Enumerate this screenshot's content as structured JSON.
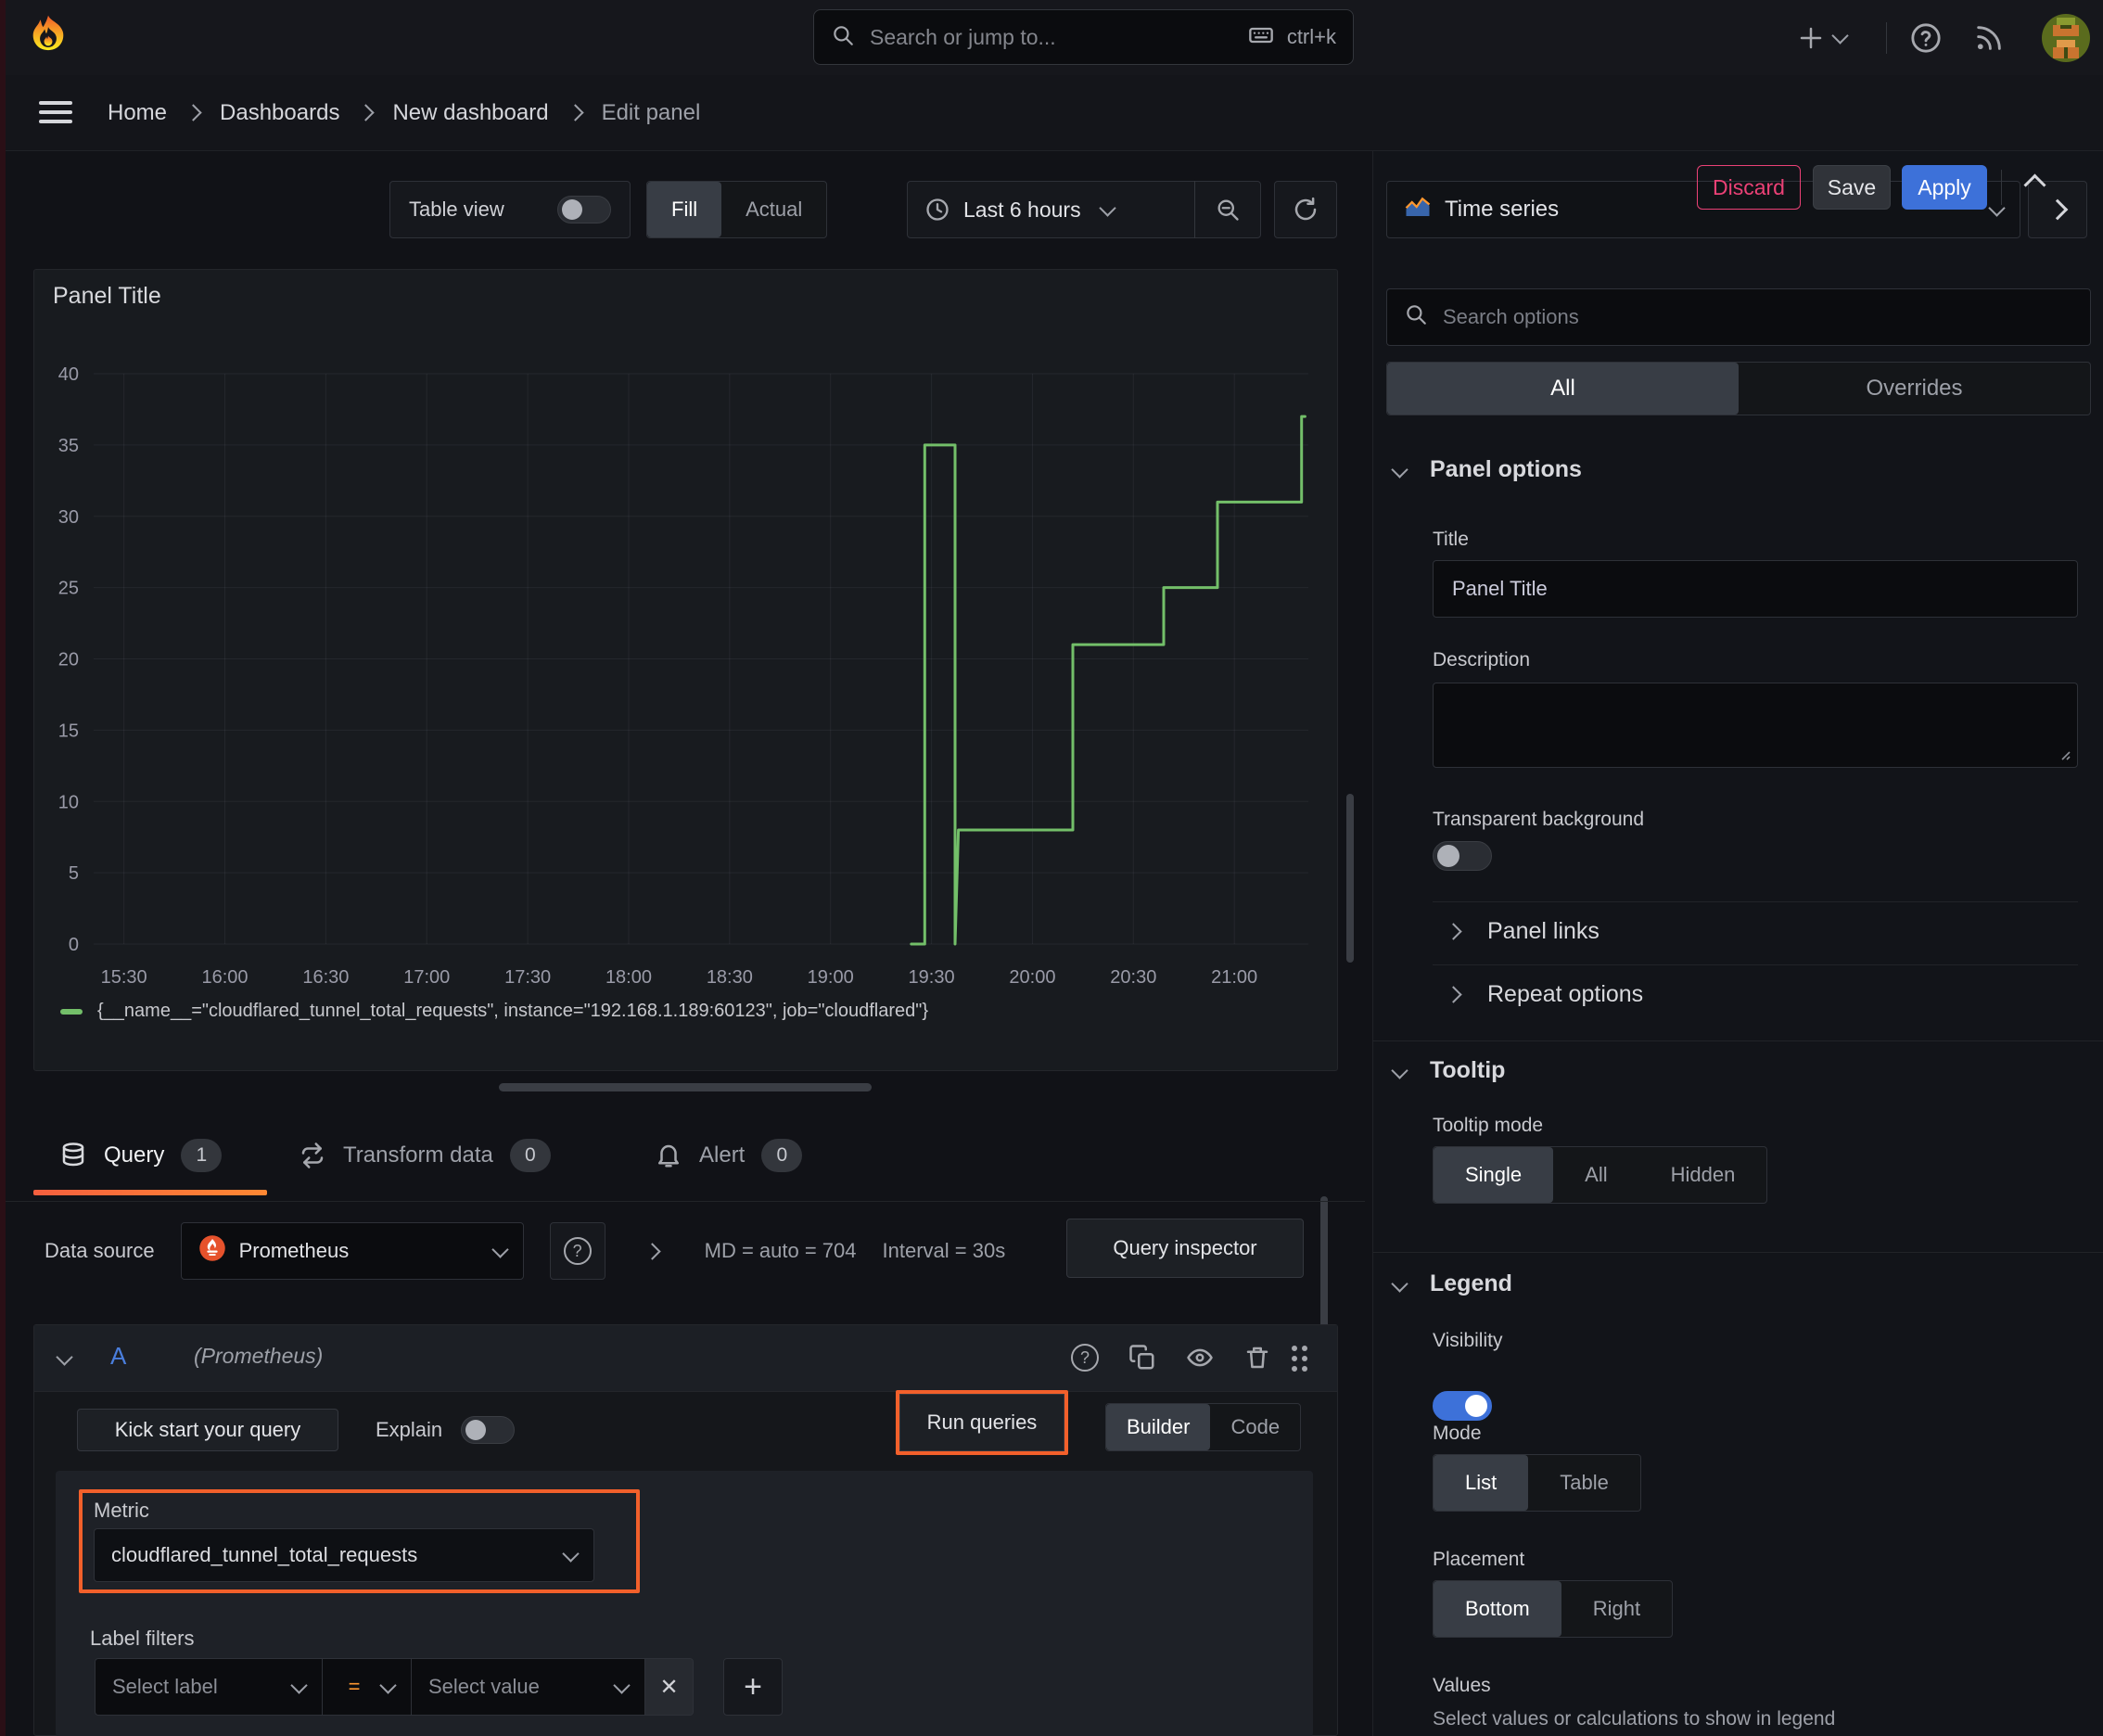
{
  "colors": {
    "green": "#73BF69",
    "blue": "#3D71D9",
    "annotation_orange": "#F2602B",
    "discard_red": "#EB4176",
    "tab_underline": "#FF8833"
  },
  "icons": {
    "plus": "+",
    "close": "✕",
    "help": "?"
  },
  "topnav": {
    "search_placeholder": "Search or jump to...",
    "shortcut": "ctrl+k"
  },
  "breadcrumb": {
    "items": [
      "Home",
      "Dashboards",
      "New dashboard",
      "Edit panel"
    ]
  },
  "actions": {
    "discard": "Discard",
    "save": "Save",
    "apply": "Apply"
  },
  "toolbar": {
    "table_view": "Table view",
    "fill": "Fill",
    "actual": "Actual",
    "time_range": "Last 6 hours"
  },
  "panel": {
    "title": "Panel Title"
  },
  "chart_data": {
    "type": "line",
    "step": true,
    "title": "Panel Title",
    "x_ticks": [
      "15:30",
      "16:00",
      "16:30",
      "17:00",
      "17:30",
      "18:00",
      "18:30",
      "19:00",
      "19:30",
      "20:00",
      "20:30",
      "21:00"
    ],
    "y_ticks": [
      0,
      5,
      10,
      15,
      20,
      25,
      30,
      35,
      40
    ],
    "x_range": [
      "15:21",
      "21:22"
    ],
    "y_range": [
      0,
      40
    ],
    "grid": true,
    "legend_position": "bottom",
    "series": [
      {
        "name": "{__name__=\"cloudflared_tunnel_total_requests\", instance=\"192.168.1.189:60123\", job=\"cloudflared\"}",
        "color": "#73BF69",
        "points": [
          {
            "time": "19:24",
            "value": 0
          },
          {
            "time": "19:28",
            "value": 0
          },
          {
            "time": "19:28",
            "value": 35
          },
          {
            "time": "19:37",
            "value": 35
          },
          {
            "time": "19:37",
            "value": 0
          },
          {
            "time": "19:38",
            "value": 8
          },
          {
            "time": "20:12",
            "value": 8
          },
          {
            "time": "20:12",
            "value": 21
          },
          {
            "time": "20:39",
            "value": 21
          },
          {
            "time": "20:39",
            "value": 25
          },
          {
            "time": "20:55",
            "value": 25
          },
          {
            "time": "20:55",
            "value": 31
          },
          {
            "time": "21:20",
            "value": 31
          },
          {
            "time": "21:20",
            "value": 37
          },
          {
            "time": "21:21",
            "value": 37
          }
        ]
      }
    ]
  },
  "tabs": {
    "query": "Query",
    "query_count": "1",
    "transform": "Transform data",
    "transform_count": "0",
    "alert": "Alert",
    "alert_count": "0"
  },
  "datasource": {
    "label": "Data source",
    "name": "Prometheus",
    "md_stat": "MD = auto = 704",
    "interval_stat": "Interval = 30s",
    "inspector": "Query inspector"
  },
  "query_row": {
    "ref": "A",
    "ds_hint": "(Prometheus)"
  },
  "query_actions": {
    "kickstart": "Kick start your query",
    "explain": "Explain",
    "run": "Run queries",
    "builder": "Builder",
    "code": "Code"
  },
  "metric": {
    "label": "Metric",
    "value": "cloudflared_tunnel_total_requests"
  },
  "label_filters": {
    "label": "Label filters",
    "select_label": "Select label",
    "operator": "=",
    "select_value": "Select value"
  },
  "sidebar": {
    "viz_name": "Time series",
    "search_placeholder": "Search options",
    "filter_tabs": {
      "all": "All",
      "overrides": "Overrides"
    },
    "panel_options": {
      "header": "Panel options",
      "title_label": "Title",
      "title_value": "Panel Title",
      "description_label": "Description",
      "transparent_label": "Transparent background",
      "links": "Panel links",
      "repeat": "Repeat options"
    },
    "tooltip": {
      "header": "Tooltip",
      "mode_label": "Tooltip mode",
      "single": "Single",
      "all": "All",
      "hidden": "Hidden"
    },
    "legend": {
      "header": "Legend",
      "visibility_label": "Visibility",
      "mode_label": "Mode",
      "list": "List",
      "table": "Table",
      "placement_label": "Placement",
      "bottom": "Bottom",
      "right": "Right",
      "values_label": "Values",
      "values_help": "Select values or calculations to show in legend"
    }
  }
}
